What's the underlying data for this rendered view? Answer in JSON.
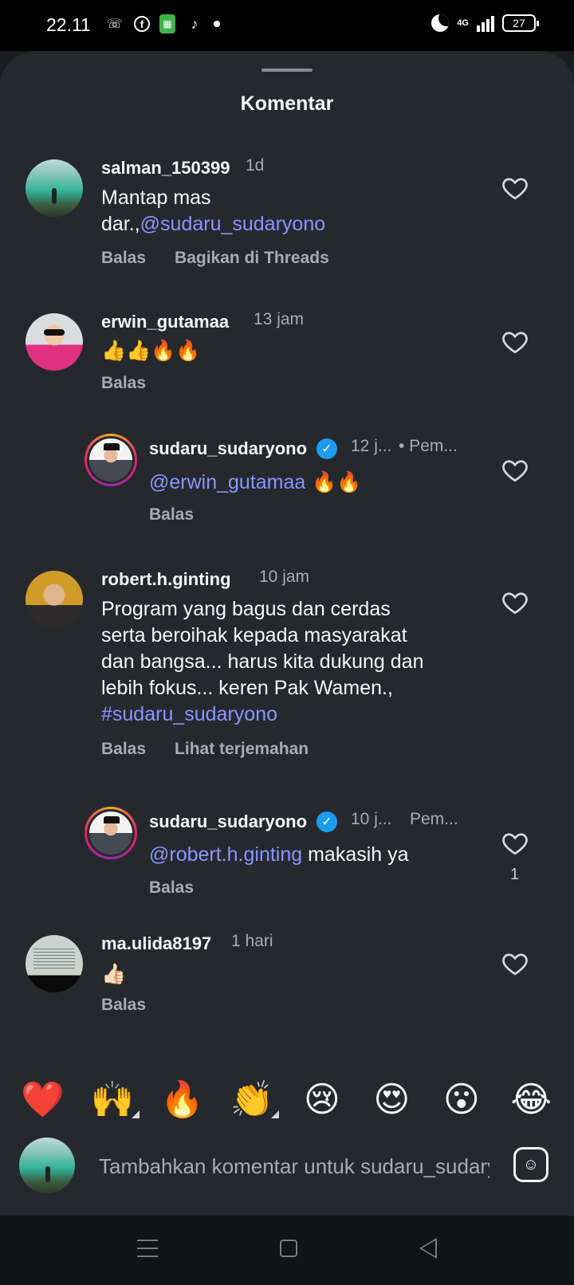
{
  "status_bar": {
    "time": "22.11",
    "network": "4G",
    "battery": "27",
    "icons": [
      "whatsapp-icon",
      "facebook-icon",
      "app-icon",
      "tiktok-icon",
      "dot-icon",
      "moon-icon",
      "signal-icon",
      "battery-icon"
    ]
  },
  "sheet": {
    "title": "Komentar"
  },
  "comments": [
    {
      "username": "salman_150399",
      "time": "1d",
      "text_lines": [
        "Mantap mas",
        "dar.,"
      ],
      "mention": "@sudaru_sudaryono",
      "actions": [
        "Balas",
        "Bagikan di Threads"
      ]
    },
    {
      "username": "erwin_gutamaa",
      "time": "13 jam",
      "text": "👍👍🔥🔥",
      "actions": [
        "Balas"
      ]
    },
    {
      "username": "sudaru_sudaryono",
      "time": "12 j...",
      "badge": "• Pem...",
      "mention": "@erwin_gutamaa",
      "text": " 🔥🔥",
      "actions": [
        "Balas"
      ]
    },
    {
      "username": "robert.h.ginting",
      "time": "10 jam",
      "text_lines": [
        "Program yang bagus dan cerdas",
        "serta beroihak kepada masyarakat",
        "dan bangsa... harus kita dukung dan",
        "lebih fokus... keren Pak Wamen.,"
      ],
      "hashtag": "#sudaru_sudaryono",
      "actions": [
        "Balas",
        "Lihat terjemahan"
      ]
    },
    {
      "username": "sudaru_sudaryono",
      "time": "10 j...",
      "badge": "Pem...",
      "mention": "@robert.h.ginting",
      "text": " makasih ya",
      "actions": [
        "Balas"
      ],
      "likes": "1"
    },
    {
      "username": "ma.ulida8197",
      "time": "1 hari",
      "text": "👍🏻",
      "actions": [
        "Balas"
      ]
    }
  ],
  "reactions": [
    "❤️",
    "🙌",
    "🔥",
    "👏",
    "😢",
    "😍",
    "😮",
    "😂"
  ],
  "composer": {
    "placeholder": "Tambahkan komentar untuk sudaru_sudaryono..."
  },
  "colors": {
    "sheet_bg": "#25292e",
    "mention": "#8c93ff",
    "verified": "#1d9bf0",
    "muted_text": "#a8abaf"
  }
}
